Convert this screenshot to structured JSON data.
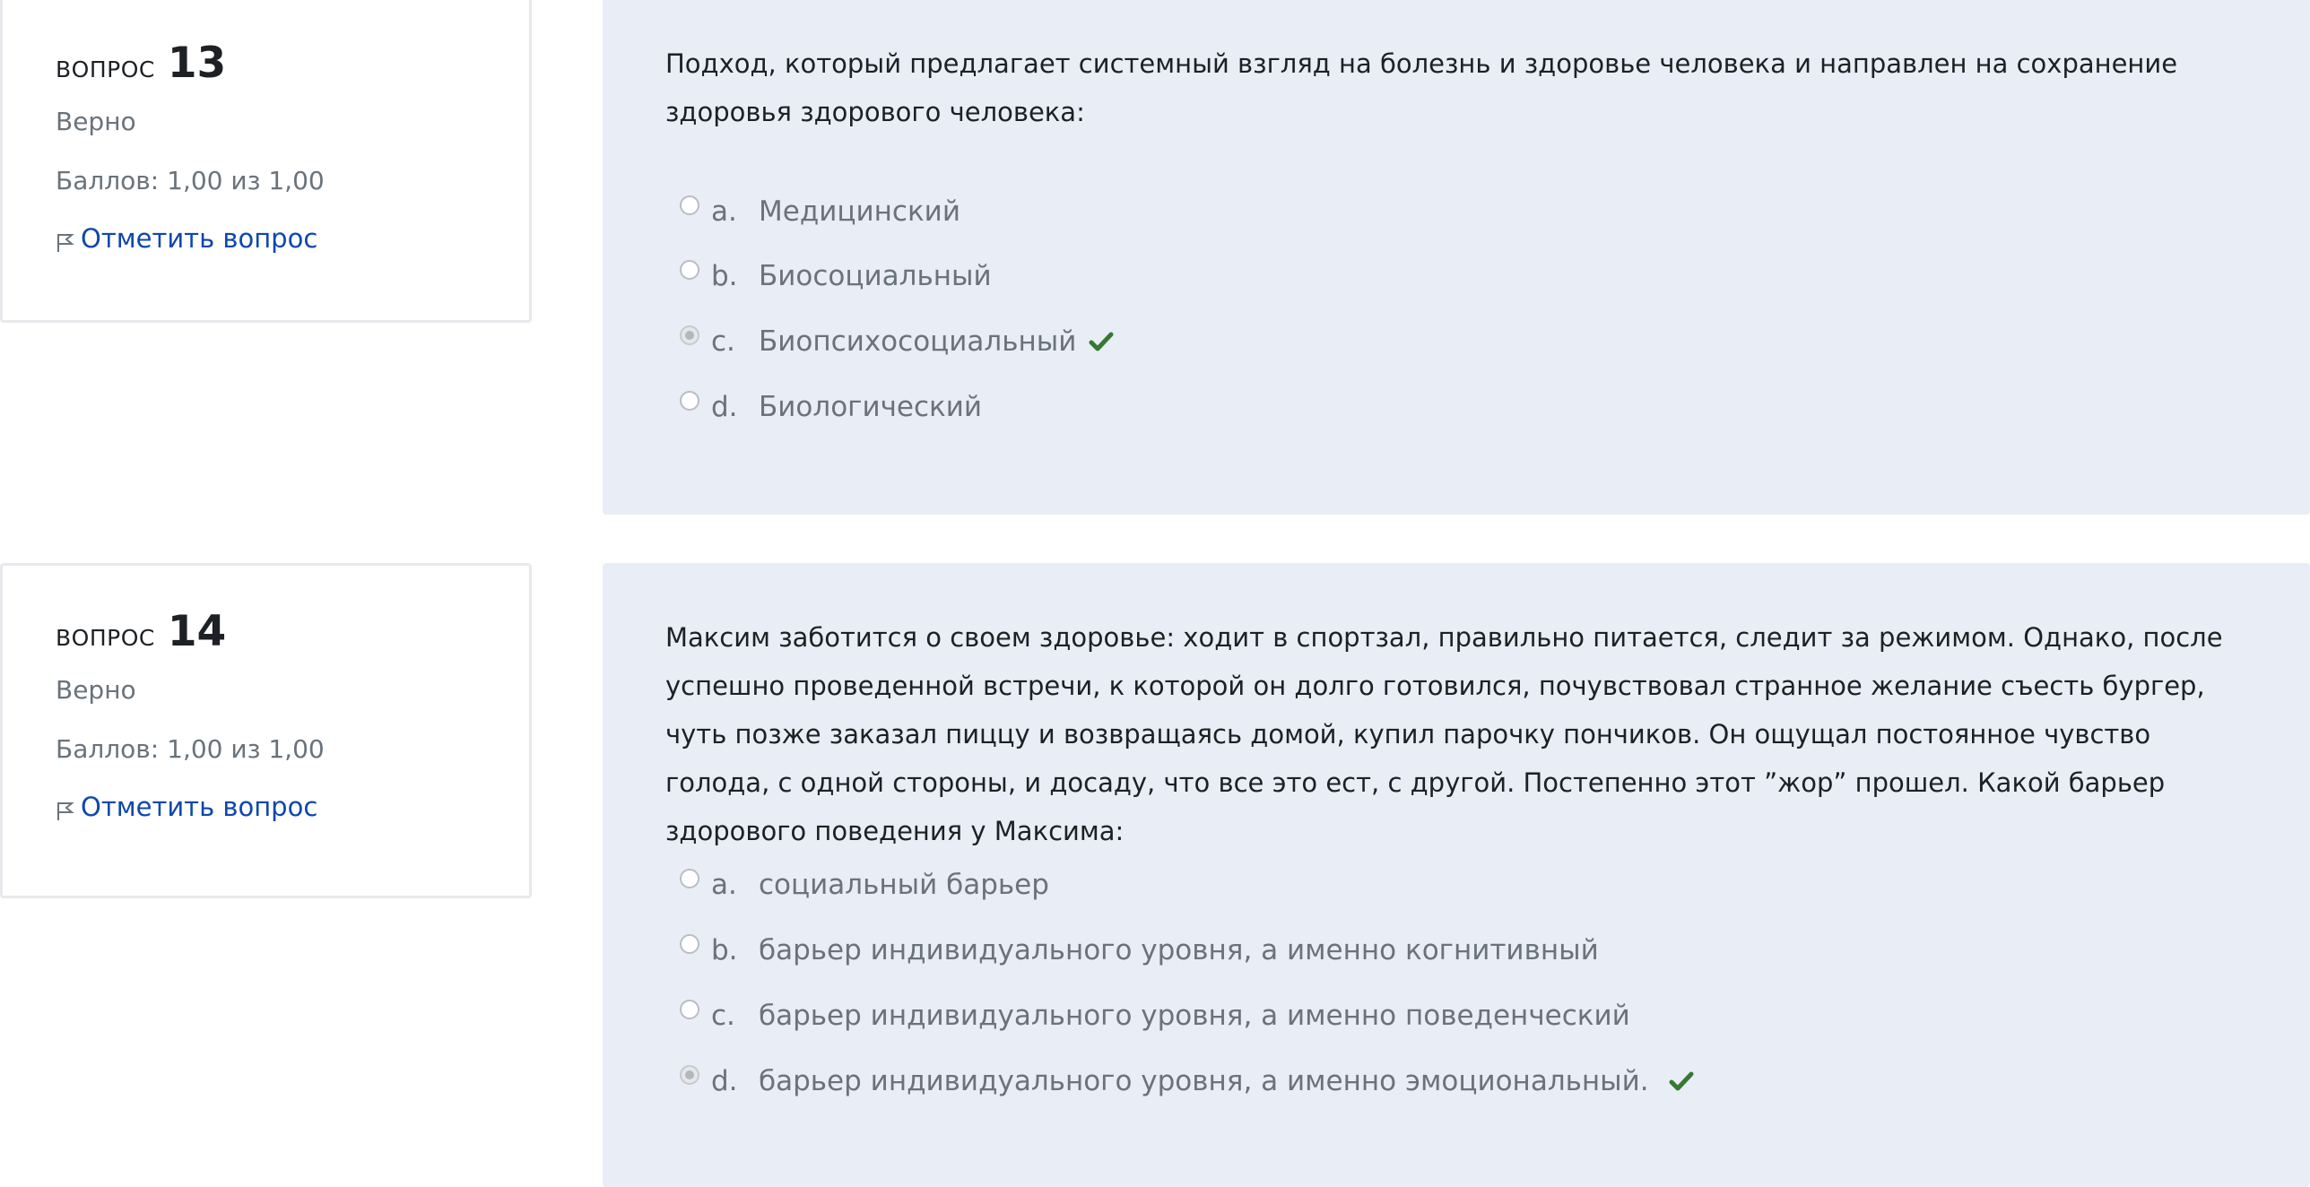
{
  "questions": [
    {
      "label": "Вопрос",
      "number": "13",
      "state": "Верно",
      "grade": "Баллов: 1,00 из 1,00",
      "flag_label": "Отметить вопрос",
      "text": "Подход, который предлагает системный взгляд на болезнь и здоровье человека и направлен на сохранение здоровья здорового человека:",
      "answers": [
        {
          "letter": "a.",
          "text": "Медицинский",
          "selected": false,
          "correct": false
        },
        {
          "letter": "b.",
          "text": "Биосоциальный",
          "selected": false,
          "correct": false
        },
        {
          "letter": "c.",
          "text": "Биопсихосоциальный",
          "selected": true,
          "correct": true
        },
        {
          "letter": "d.",
          "text": "Биологический",
          "selected": false,
          "correct": false
        }
      ]
    },
    {
      "label": "Вопрос",
      "number": "14",
      "state": "Верно",
      "grade": "Баллов: 1,00 из 1,00",
      "flag_label": "Отметить вопрос",
      "text": "Максим заботится о своем здоровье: ходит в спортзал, правильно питается, следит за режимом. Однако, после успешно проведенной встречи, к которой он долго готовился, почувствовал странное желание съесть бургер, чуть позже заказал пиццу и возвращаясь домой, купил парочку пончиков. Он ощущал постоянное чувство голода, с одной стороны, и досаду, что все это ест, с другой. Постепенно этот ”жор” прошел. Какой барьер здорового поведения у Максима:",
      "answers": [
        {
          "letter": "a.",
          "text": "социальный барьер",
          "selected": false,
          "correct": false
        },
        {
          "letter": "b.",
          "text": "барьер индивидуального уровня, а именно когнитивный",
          "selected": false,
          "correct": false
        },
        {
          "letter": "c.",
          "text": "барьер индивидуального уровня, а именно поведенческий",
          "selected": false,
          "correct": false
        },
        {
          "letter": "d.",
          "text": "барьер индивидуального уровня, а именно эмоциональный.",
          "selected": true,
          "correct": true
        }
      ]
    }
  ],
  "icons": {
    "flag": "flag-icon",
    "check": "check-icon"
  },
  "colors": {
    "link": "#0f47ad",
    "correct": "#357a32",
    "content_bg": "#e9edf5"
  }
}
